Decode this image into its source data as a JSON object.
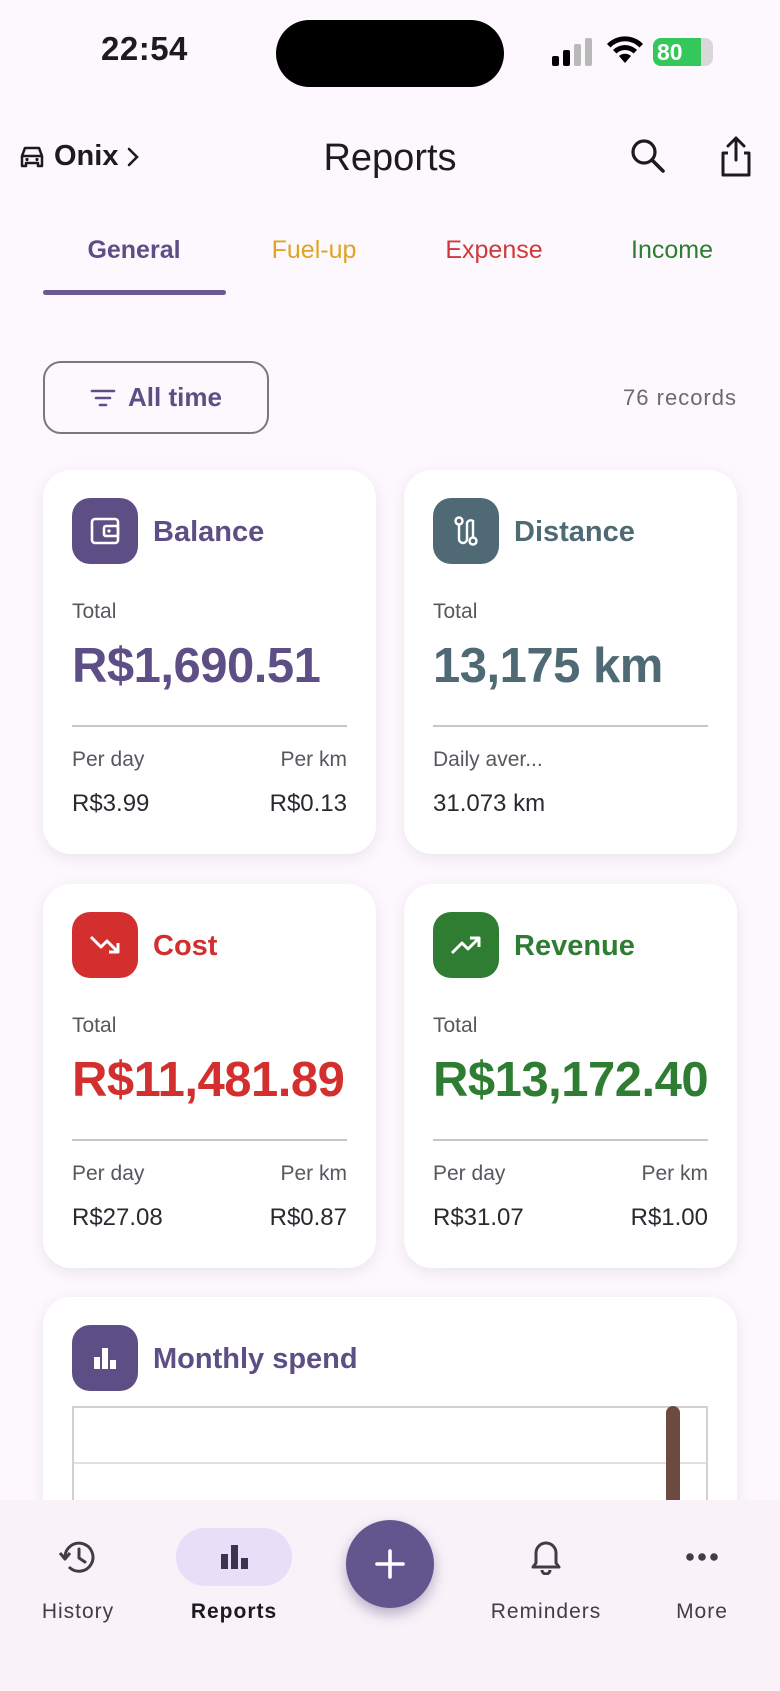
{
  "status_bar": {
    "time": "22:54",
    "battery": "80",
    "battery_level": 0.8
  },
  "header": {
    "vehicle": "Onix",
    "title": "Reports"
  },
  "tabs": [
    {
      "label": "General",
      "color": "#5d4f86",
      "active": true
    },
    {
      "label": "Fuel-up",
      "color": "#e0a422",
      "active": false
    },
    {
      "label": "Expense",
      "color": "#d0393a",
      "active": false
    },
    {
      "label": "Income",
      "color": "#2e7d32",
      "active": false
    }
  ],
  "filter": {
    "label": "All time",
    "records": "76 records"
  },
  "cards": {
    "balance": {
      "title": "Balance",
      "color": "#5d4f86",
      "sub": "Total",
      "value": "R$1,690.51",
      "left_label": "Per day",
      "left_value": "R$3.99",
      "right_label": "Per km",
      "right_value": "R$0.13"
    },
    "distance": {
      "title": "Distance",
      "color": "#4f6a74",
      "sub": "Total",
      "value": "13,175 km",
      "left_label": "Daily aver...",
      "left_value": "31.073 km"
    },
    "cost": {
      "title": "Cost",
      "color": "#d32f2f",
      "sub": "Total",
      "value": "R$11,481.89",
      "left_label": "Per day",
      "left_value": "R$27.08",
      "right_label": "Per km",
      "right_value": "R$0.87"
    },
    "revenue": {
      "title": "Revenue",
      "color": "#2e7d32",
      "sub": "Total",
      "value": "R$13,172.40",
      "left_label": "Per day",
      "left_value": "R$31.07",
      "right_label": "Per km",
      "right_value": "R$1.00"
    }
  },
  "monthly": {
    "title": "Monthly spend",
    "color": "#5d4f86"
  },
  "nav": {
    "history": "History",
    "reports": "Reports",
    "reminders": "Reminders",
    "more": "More"
  },
  "icons": {
    "vehicle": "car-icon",
    "search": "search-icon",
    "share": "share-icon",
    "filter": "filter-icon",
    "balance": "wallet-icon",
    "distance": "route-icon",
    "cost": "trending-down-icon",
    "revenue": "trending-up-icon",
    "monthly": "bar-chart-icon",
    "fab": "plus-icon"
  }
}
